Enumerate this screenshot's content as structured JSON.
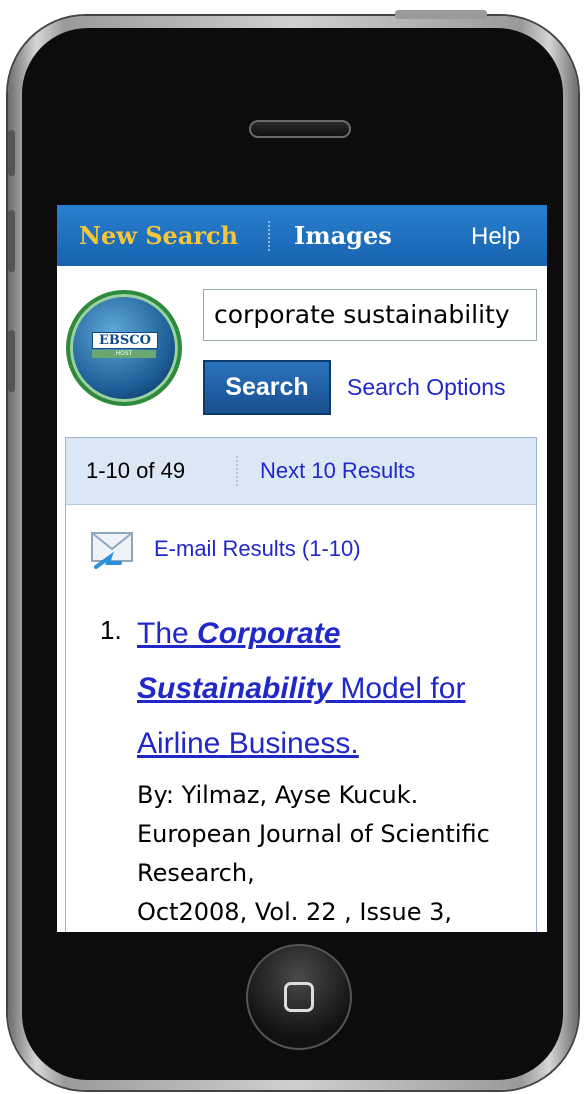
{
  "nav": {
    "new_search": "New Search",
    "images": "Images",
    "help": "Help"
  },
  "logo": {
    "text": "EBSCO",
    "sub": "HOST"
  },
  "search": {
    "value": "corporate sustainability",
    "button": "Search",
    "options": "Search Options"
  },
  "results": {
    "count": "1-10 of 49",
    "next": "Next 10 Results",
    "email": "E-mail Results (1-10)",
    "items": [
      {
        "number": "1.",
        "title_prefix": "The ",
        "title_hl1": "Corporate",
        "title_hl2": "Sustainability",
        "title_suffix": " Model for Airline Business.",
        "by": "By: Yilmaz, Ayse Kucuk.",
        "journal": "European Journal of Scientific Research,",
        "date": "Oct2008, Vol. 22 , Issue 3,"
      }
    ]
  }
}
